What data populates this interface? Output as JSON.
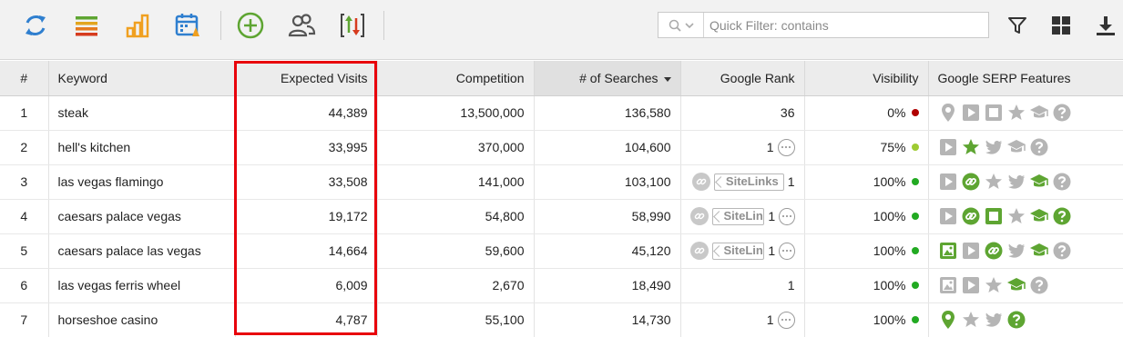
{
  "colors": {
    "accent_green": "#5ea532",
    "grey_icon": "#b5b5b5",
    "visibility_low": "#b00000",
    "visibility_mid": "#9ecb32",
    "visibility_high": "#22aa22",
    "highlight_box": "#e8000b"
  },
  "toolbar": {
    "icons": [
      "refresh-icon",
      "list-icon",
      "bar-chart-icon",
      "calendar-alert-icon",
      "add-circle-icon",
      "users-icon",
      "sort-updown-icon",
      "filter-icon",
      "grid-view-icon",
      "download-icon"
    ],
    "quick_filter": {
      "placeholder": "Quick Filter: contains",
      "value": ""
    }
  },
  "table": {
    "headers": {
      "num": "#",
      "keyword": "Keyword",
      "expected_visits": "Expected Visits",
      "competition": "Competition",
      "searches": "# of Searches",
      "google_rank": "Google Rank",
      "visibility": "Visibility",
      "serp_features": "Google SERP Features"
    },
    "sorted_by": "# of Searches",
    "rows": [
      {
        "num": "1",
        "keyword": "steak",
        "visits": "44,389",
        "competition": "13,500,000",
        "searches": "136,580",
        "rank": "36",
        "rank_more": false,
        "sitelinks": "",
        "visibility": "0%",
        "vis_level": "low",
        "features": [
          [
            "local-pin-icon",
            false
          ],
          [
            "video-icon",
            false
          ],
          [
            "image-box-icon",
            false
          ],
          [
            "star-icon",
            false
          ],
          [
            "graduation-cap-icon",
            false
          ],
          [
            "question-icon",
            false
          ]
        ]
      },
      {
        "num": "2",
        "keyword": "hell's kitchen",
        "visits": "33,995",
        "competition": "370,000",
        "searches": "104,600",
        "rank": "1",
        "rank_more": true,
        "sitelinks": "",
        "visibility": "75%",
        "vis_level": "mid",
        "features": [
          [
            "video-icon",
            false
          ],
          [
            "star-icon",
            true
          ],
          [
            "twitter-icon",
            false
          ],
          [
            "graduation-cap-icon",
            false
          ],
          [
            "question-icon",
            false
          ]
        ]
      },
      {
        "num": "3",
        "keyword": "las vegas flamingo",
        "visits": "33,508",
        "competition": "141,000",
        "searches": "103,100",
        "rank": "1",
        "rank_more": false,
        "sitelinks": "SiteLinks",
        "visibility": "100%",
        "vis_level": "high",
        "features": [
          [
            "video-icon",
            false
          ],
          [
            "link-icon",
            true
          ],
          [
            "star-icon",
            false
          ],
          [
            "twitter-icon",
            false
          ],
          [
            "graduation-cap-icon",
            true
          ],
          [
            "question-icon",
            false
          ]
        ]
      },
      {
        "num": "4",
        "keyword": "caesars palace vegas",
        "visits": "19,172",
        "competition": "54,800",
        "searches": "58,990",
        "rank": "1",
        "rank_more": true,
        "sitelinks": "SiteLin",
        "visibility": "100%",
        "vis_level": "high",
        "features": [
          [
            "video-icon",
            false
          ],
          [
            "link-icon",
            true
          ],
          [
            "image-box-icon",
            true
          ],
          [
            "star-icon",
            false
          ],
          [
            "graduation-cap-icon",
            true
          ],
          [
            "question-icon",
            true
          ]
        ]
      },
      {
        "num": "5",
        "keyword": "caesars palace las vegas",
        "visits": "14,664",
        "competition": "59,600",
        "searches": "45,120",
        "rank": "1",
        "rank_more": true,
        "sitelinks": "SiteLin",
        "visibility": "100%",
        "vis_level": "high",
        "features": [
          [
            "picture-icon",
            true
          ],
          [
            "video-icon",
            false
          ],
          [
            "link-icon",
            true
          ],
          [
            "twitter-icon",
            false
          ],
          [
            "graduation-cap-icon",
            true
          ],
          [
            "question-icon",
            false
          ]
        ]
      },
      {
        "num": "6",
        "keyword": "las vegas ferris wheel",
        "visits": "6,009",
        "competition": "2,670",
        "searches": "18,490",
        "rank": "1",
        "rank_more": false,
        "sitelinks": "",
        "visibility": "100%",
        "vis_level": "high",
        "features": [
          [
            "picture-icon",
            false
          ],
          [
            "video-icon",
            false
          ],
          [
            "star-icon",
            false
          ],
          [
            "graduation-cap-icon",
            true
          ],
          [
            "question-icon",
            false
          ]
        ]
      },
      {
        "num": "7",
        "keyword": "horseshoe casino",
        "visits": "4,787",
        "competition": "55,100",
        "searches": "14,730",
        "rank": "1",
        "rank_more": true,
        "sitelinks": "",
        "visibility": "100%",
        "vis_level": "high",
        "features": [
          [
            "local-pin-icon",
            true
          ],
          [
            "star-icon",
            false
          ],
          [
            "twitter-icon",
            false
          ],
          [
            "question-icon",
            true
          ]
        ]
      }
    ]
  }
}
